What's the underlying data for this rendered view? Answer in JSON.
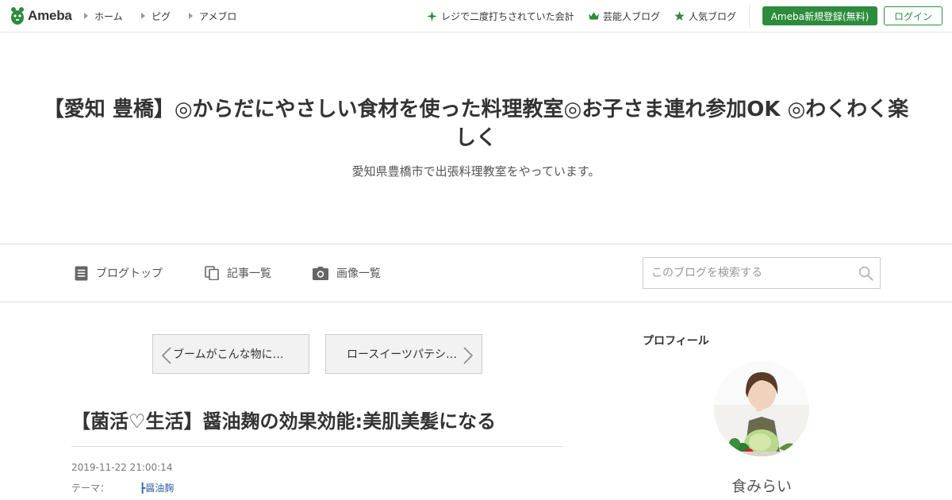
{
  "header": {
    "logo_text": "Ameba",
    "nav": [
      "ホーム",
      "ピグ",
      "アメブロ"
    ],
    "links": [
      {
        "label": "レジで二度打ちされていた会計",
        "icon": "sparkle-icon"
      },
      {
        "label": "芸能人ブログ",
        "icon": "crown-icon"
      },
      {
        "label": "人気ブログ",
        "icon": "star-icon"
      }
    ],
    "register_label": "Ameba新規登録(無料)",
    "login_label": "ログイン",
    "accent_color": "#2d8c3c"
  },
  "blog": {
    "title": "【愛知 豊橋】◎からだにやさしい食材を使った料理教室◎お子さま連れ参加OK ◎わくわく楽しく",
    "description": "愛知県豊橋市で出張料理教室をやっています。"
  },
  "menu": {
    "items": [
      {
        "label": "ブログトップ",
        "icon": "document-icon"
      },
      {
        "label": "記事一覧",
        "icon": "copy-icon"
      },
      {
        "label": "画像一覧",
        "icon": "camera-icon"
      }
    ],
    "search_placeholder": "このブログを検索する"
  },
  "pager": {
    "prev": "ブームがこんな物に…",
    "next": "ロースイーツパテシ…"
  },
  "article": {
    "title": "【菌活♡生活】醤油麹の効果効能:美肌美髪になる",
    "date": "2019-11-22 21:00:14",
    "theme_label": "テーマ：",
    "theme": "┣醤油麹"
  },
  "profile": {
    "heading": "プロフィール",
    "name": "食みらい"
  }
}
